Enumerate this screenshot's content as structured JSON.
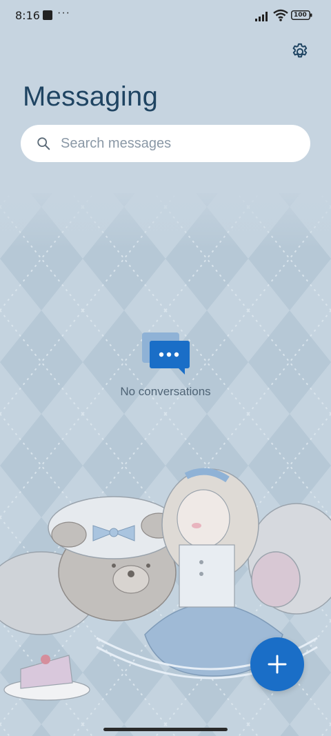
{
  "status_bar": {
    "time": "8:16",
    "more_indicator": "···",
    "battery": "100",
    "icons": [
      "signal-icon",
      "wifi-icon",
      "battery-icon"
    ]
  },
  "header": {
    "title": "Messaging",
    "settings_icon": "gear-icon"
  },
  "search": {
    "placeholder": "Search messages",
    "value": "",
    "icon": "search-icon"
  },
  "empty_state": {
    "icon": "chat-bubble-icon",
    "text": "No conversations"
  },
  "fab": {
    "icon": "plus-icon"
  },
  "colors": {
    "accent": "#1a6ec7",
    "background": "#c6d4e0",
    "title": "#1f4462"
  }
}
